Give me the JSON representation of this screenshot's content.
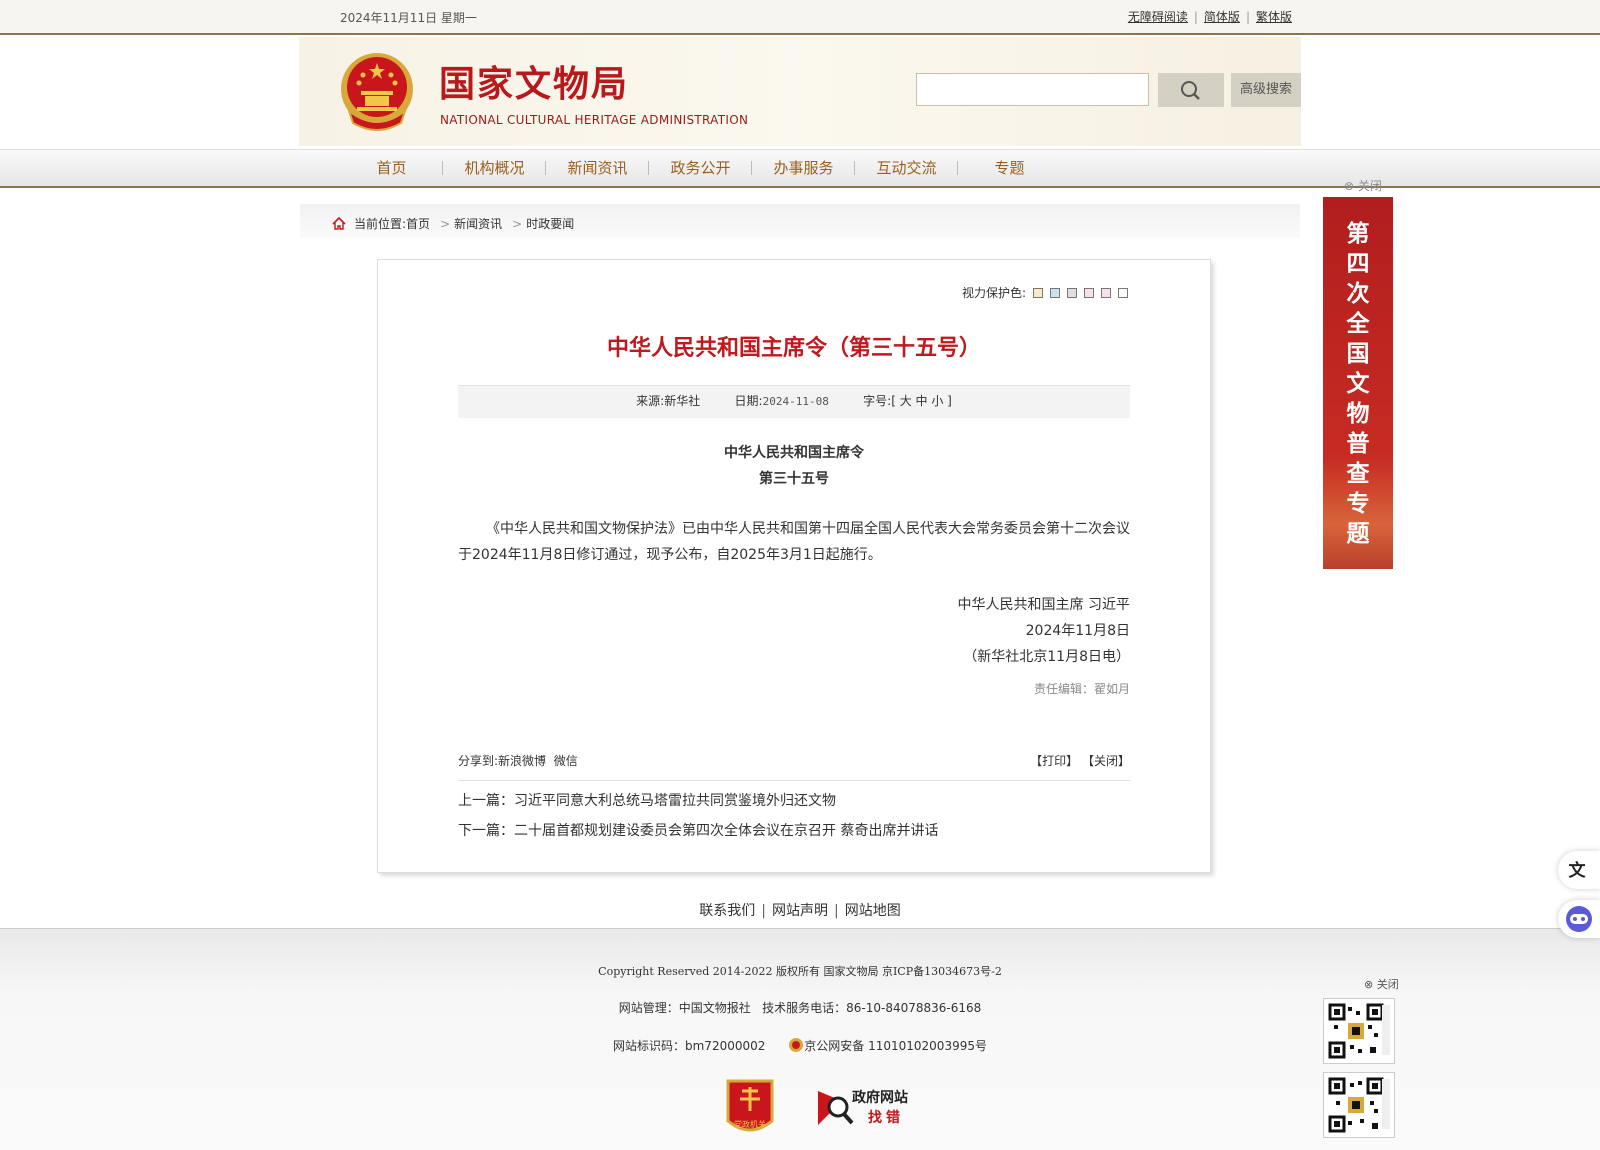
{
  "topbar": {
    "date": "2024年11月11日 星期一",
    "accessible": "无障碍阅读",
    "simplified": "简体版",
    "traditional": "繁体版"
  },
  "header": {
    "site_name": "国家文物局",
    "site_name_en": "NATIONAL CULTURAL HERITAGE ADMINISTRATION",
    "search_placeholder": "",
    "advanced_search": "高级搜索"
  },
  "nav": [
    "首页",
    "机构概况",
    "新闻资讯",
    "政务公开",
    "办事服务",
    "互动交流",
    "专题"
  ],
  "side_banner": {
    "close": "关闭",
    "text": "第四次全国文物普查专题"
  },
  "breadcrumb": {
    "label": "当前位置:",
    "items": [
      "首页",
      "新闻资讯",
      "时政要闻"
    ]
  },
  "article": {
    "vision_label": "视力保护色:",
    "vision_colors": [
      "#f7ebc4",
      "#c5e3f2",
      "#dedede",
      "#f6dfe6",
      "#f5e0eb",
      "#ffffff"
    ],
    "title": "中华人民共和国主席令（第三十五号）",
    "source_label": "来源:",
    "source": "新华社",
    "date_label": "日期:",
    "date": "2024-11-08",
    "font_label": "字号:",
    "font_sizes": "[ 大 中 小 ]",
    "heading1": "中华人民共和国主席令",
    "heading2": "第三十五号",
    "body": "《中华人民共和国文物保护法》已由中华人民共和国第十四届全国人民代表大会常务委员会第十二次会议于2024年11月8日修订通过，现予公布，自2025年3月1日起施行。",
    "sign1": "中华人民共和国主席 习近平",
    "sign2": "2024年11月8日",
    "sign3": "（新华社北京11月8日电）",
    "editor": "责任编辑：翟如月",
    "share_label": "分享到:",
    "share_weibo": "新浪微博",
    "share_wechat": "微信",
    "print": "【打印】",
    "close": "【关闭】",
    "prev_label": "上一篇：",
    "prev": "习近平同意大利总统马塔雷拉共同赏鉴境外归还文物",
    "next_label": "下一篇：",
    "next": "二十届首都规划建设委员会第四次全体会议在京召开 蔡奇出席并讲话"
  },
  "footer": {
    "links": [
      "联系我们",
      "网站声明",
      "网站地图"
    ],
    "copyright": "Copyright Reserved 2014-2022 版权所有 国家文物局 京ICP备13034673号-2",
    "manage": "网站管理：中国文物报社",
    "phone": "技术服务电话：86-10-84078836-6168",
    "site_id": "网站标识码：bm72000002",
    "police": "京公网安备 11010102003995号",
    "party_badge": "党政机关",
    "error_t1": "政府网站",
    "error_t2": "找错",
    "qr_close": "关闭"
  }
}
